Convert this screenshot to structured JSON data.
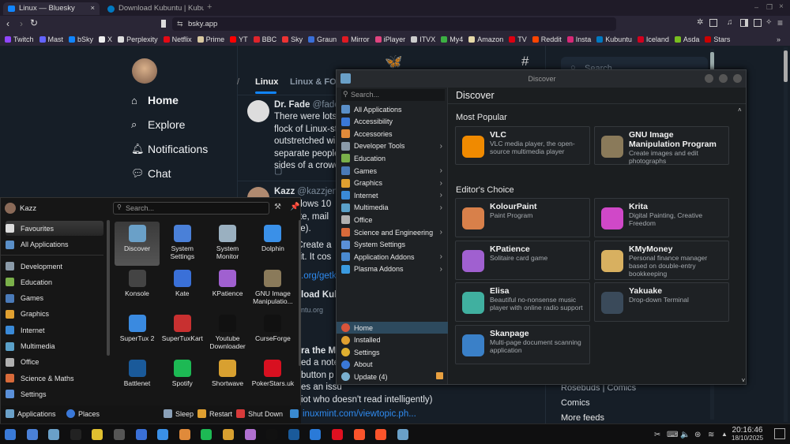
{
  "browser": {
    "tabs": [
      {
        "label": "Linux — Bluesky",
        "active": true,
        "icon": "bluesky-icon"
      },
      {
        "label": "Download Kubuntu | Kubun",
        "active": false,
        "icon": "kubuntu-icon"
      }
    ],
    "new_tab": "+",
    "url": "bsky.app",
    "bookmarks": [
      {
        "label": "Twitch",
        "color": "#9146ff"
      },
      {
        "label": "Mast",
        "color": "#6364ff"
      },
      {
        "label": "bSky",
        "color": "#1185fe"
      },
      {
        "label": "X",
        "color": "#eeeeee"
      },
      {
        "label": "Perplexity",
        "color": "#dddddd"
      },
      {
        "label": "Netflix",
        "color": "#e50914"
      },
      {
        "label": "Prime",
        "color": "#d8c8a0"
      },
      {
        "label": "YT",
        "color": "#ff0000"
      },
      {
        "label": "BBC",
        "color": "#e0242b"
      },
      {
        "label": "Sky",
        "color": "#e33"
      },
      {
        "label": "Graun",
        "color": "#3a6fd8"
      },
      {
        "label": "Mirror",
        "color": "#e01a22"
      },
      {
        "label": "iPlayer",
        "color": "#e0447f"
      },
      {
        "label": "ITVX",
        "color": "#ccc"
      },
      {
        "label": "My4",
        "color": "#3cb043"
      },
      {
        "label": "Amazon",
        "color": "#e6d9a8"
      },
      {
        "label": "TV",
        "color": "#d01"
      },
      {
        "label": "Reddit",
        "color": "#ff4500"
      },
      {
        "label": "Insta",
        "color": "#d62976"
      },
      {
        "label": "Kubuntu",
        "color": "#0079c1"
      },
      {
        "label": "Iceland",
        "color": "#d2001e"
      },
      {
        "label": "Asda",
        "color": "#78be20"
      },
      {
        "label": "Stars",
        "color": "#c00"
      }
    ],
    "overflow": "»"
  },
  "bluesky": {
    "nav": [
      {
        "label": "Home",
        "icon": "home-icon",
        "active": true
      },
      {
        "label": "Explore",
        "icon": "search-icon"
      },
      {
        "label": "Notifications",
        "icon": "bell-icon"
      },
      {
        "label": "Chat",
        "icon": "chat-icon"
      }
    ],
    "feed_tabs": [
      "Linux",
      "Linux & FOS"
    ],
    "post1": {
      "name": "Dr. Fade",
      "handle": "@fade.b",
      "lines": [
        "There were lots c",
        "flock of Linux-sty",
        "outstretched win",
        "separate people",
        "sides of a crowd."
      ]
    },
    "post2": {
      "name": "Kazz",
      "handle": "@kazzjenk",
      "lines": [
        "ndows 10",
        "uite, mail",
        "ore).",
        "' Create a",
        "g it. It cos"
      ],
      "link": ".org/getk",
      "card_title": "load Kub",
      "card_domain": "ntu.org"
    },
    "post3": {
      "name": "ra the Ma",
      "lines": [
        "ed a note",
        "button p",
        "es an issu",
        "iot who doesn't read intelligently)"
      ],
      "link": "inuxmint.com/viewtopic.ph..."
    },
    "search_placeholder": "Search",
    "feeds": [
      "Rosebuds | Comics",
      "Comics"
    ],
    "more_feeds": "More feeds"
  },
  "discover": {
    "title": "Discover",
    "search_placeholder": "Search...",
    "header": "Discover",
    "categories": [
      {
        "label": "All Applications",
        "color": "#5a8fc8"
      },
      {
        "label": "Accessibility",
        "color": "#3a78d8"
      },
      {
        "label": "Accessories",
        "color": "#e08a3a"
      },
      {
        "label": "Developer Tools",
        "sub": true,
        "color": "#8a9aa8"
      },
      {
        "label": "Education",
        "color": "#7ab04a"
      },
      {
        "label": "Games",
        "sub": true,
        "color": "#4a7ab8"
      },
      {
        "label": "Graphics",
        "sub": true,
        "color": "#e0a030"
      },
      {
        "label": "Internet",
        "sub": true,
        "color": "#3a8ad8"
      },
      {
        "label": "Multimedia",
        "sub": true,
        "color": "#5aa0c8"
      },
      {
        "label": "Office",
        "color": "#b0b0b0"
      },
      {
        "label": "Science and Engineering",
        "sub": true,
        "color": "#d86a3a"
      },
      {
        "label": "System Settings",
        "color": "#5a8fd8"
      },
      {
        "label": "Application Addons",
        "sub": true,
        "color": "#4a8ad0"
      },
      {
        "label": "Plasma Addons",
        "sub": true,
        "color": "#3a9ae0"
      }
    ],
    "bottom": [
      {
        "label": "Home",
        "active": true,
        "color": "#d8543a"
      },
      {
        "label": "Installed",
        "color": "#e0a030"
      },
      {
        "label": "Settings",
        "color": "#e0b030"
      },
      {
        "label": "About",
        "color": "#3a78d8"
      },
      {
        "label": "Update (4)",
        "color": "#7ab0d0",
        "badge": true
      }
    ],
    "most_popular": "Most Popular",
    "popular": [
      {
        "name": "VLC",
        "desc": "VLC media player, the open-source multimedia player",
        "color": "#f08a00"
      },
      {
        "name": "GNU Image Manipulation Program",
        "desc": "Create images and edit photographs",
        "color": "#8a7a5a"
      }
    ],
    "editors_choice": "Editor's Choice",
    "editors": [
      {
        "name": "KolourPaint",
        "desc": "Paint Program",
        "color": "#d8804a"
      },
      {
        "name": "Krita",
        "desc": "Digital Painting, Creative Freedom",
        "color": "#d048c8"
      },
      {
        "name": "KPatience",
        "desc": "Solitaire card game",
        "color": "#a060d0"
      },
      {
        "name": "KMyMoney",
        "desc": "Personal finance manager based on double-entry bookkeeping",
        "color": "#d8b060"
      },
      {
        "name": "Elisa",
        "desc": "Beautiful no-nonsense music player with online radio support",
        "color": "#40b0a0"
      },
      {
        "name": "Yakuake",
        "desc": "Drop-down Terminal",
        "color": "#3a4a5a"
      },
      {
        "name": "Skanpage",
        "desc": "Multi-page document scanning application",
        "color": "#3a80c8"
      }
    ]
  },
  "launcher": {
    "user": "Kazz",
    "search_placeholder": "Search...",
    "categories": [
      {
        "label": "Favourites",
        "active": true,
        "color": "#ddd"
      },
      {
        "label": "All Applications",
        "color": "#5a8fc8"
      },
      {
        "label": "Development",
        "color": "#8a9aa8"
      },
      {
        "label": "Education",
        "color": "#7ab04a"
      },
      {
        "label": "Games",
        "color": "#4a7ab8"
      },
      {
        "label": "Graphics",
        "color": "#e0a030"
      },
      {
        "label": "Internet",
        "color": "#3a8ad8"
      },
      {
        "label": "Multimedia",
        "color": "#5aa0c8"
      },
      {
        "label": "Office",
        "color": "#b0b0b0"
      },
      {
        "label": "Science & Maths",
        "color": "#d86a3a"
      },
      {
        "label": "Settings",
        "color": "#5a8fd8"
      }
    ],
    "apps": [
      {
        "label": "Discover",
        "color": "#6aa0c8",
        "active": true
      },
      {
        "label": "System Settings",
        "color": "#4a80d8"
      },
      {
        "label": "System Monitor",
        "color": "#9ab0c0"
      },
      {
        "label": "Dolphin",
        "color": "#3a90e8"
      },
      {
        "label": "Konsole",
        "color": "#444"
      },
      {
        "label": "Kate",
        "color": "#3a70d8"
      },
      {
        "label": "KPatience",
        "color": "#a060d0"
      },
      {
        "label": "GNU Image Manipulatio...",
        "color": "#8a7a5a"
      },
      {
        "label": "SuperTux 2",
        "color": "#3a8ae0"
      },
      {
        "label": "SuperTuxKart",
        "color": "#c83030"
      },
      {
        "label": "Youtube Downloader",
        "color": "#111"
      },
      {
        "label": "CurseForge",
        "color": "#111"
      },
      {
        "label": "Battlenet",
        "color": "#1a5a9a"
      },
      {
        "label": "Spotify",
        "color": "#1db954"
      },
      {
        "label": "Shortwave",
        "color": "#d8a030"
      },
      {
        "label": "PokerStars.uk",
        "color": "#d81020"
      }
    ],
    "footer": {
      "applications": "Applications",
      "places": "Places",
      "sleep": "Sleep",
      "restart": "Restart",
      "shutdown": "Shut Down"
    }
  },
  "taskbar": {
    "apps": [
      {
        "name": "kde-menu",
        "color": "#3a7ad8"
      },
      {
        "name": "system-settings",
        "color": "#4a80d8"
      },
      {
        "name": "discover",
        "color": "#6aa0c8"
      },
      {
        "name": "vivaldi",
        "color": "#222"
      },
      {
        "name": "ktuberling",
        "color": "#e0c030"
      },
      {
        "name": "konsole",
        "color": "#555"
      },
      {
        "name": "kate",
        "color": "#3a70d8"
      },
      {
        "name": "dolphin",
        "color": "#3a90e8"
      },
      {
        "name": "layers",
        "color": "#e08a3a"
      },
      {
        "name": "spotify",
        "color": "#1db954"
      },
      {
        "name": "shortwave",
        "color": "#d8a030"
      },
      {
        "name": "kpatience",
        "color": "#b070d0"
      },
      {
        "name": "curseforge",
        "color": "#111"
      },
      {
        "name": "battlenet",
        "color": "#1a5a9a"
      },
      {
        "name": "thunderbird",
        "color": "#2a7ad8"
      },
      {
        "name": "opera",
        "color": "#e01020"
      },
      {
        "name": "brave",
        "color": "#fb542b"
      },
      {
        "name": "brave-2",
        "color": "#fb542b"
      },
      {
        "name": "discover-2",
        "color": "#6aa0c8"
      }
    ],
    "time": "20:16:46",
    "date": "18/10/2025"
  }
}
